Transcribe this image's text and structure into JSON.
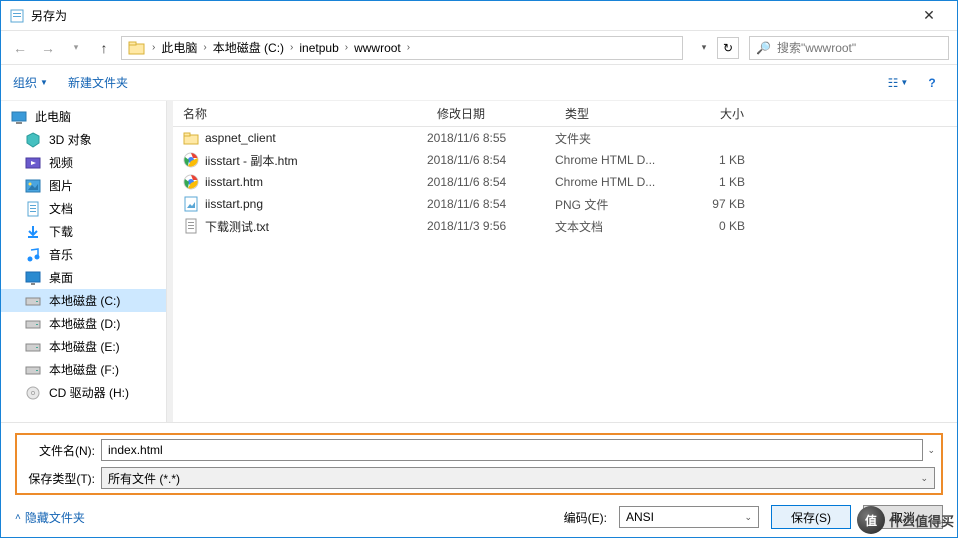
{
  "title": "另存为",
  "breadcrumbs": [
    "此电脑",
    "本地磁盘 (C:)",
    "inetpub",
    "wwwroot"
  ],
  "search_placeholder": "搜索\"wwwroot\"",
  "toolbar": {
    "organize": "组织",
    "newfolder": "新建文件夹"
  },
  "columns": {
    "name": "名称",
    "date": "修改日期",
    "type": "类型",
    "size": "大小"
  },
  "sidebar": [
    {
      "label": "此电脑",
      "icon": "pc",
      "root": true
    },
    {
      "label": "3D 对象",
      "icon": "cube"
    },
    {
      "label": "视频",
      "icon": "video"
    },
    {
      "label": "图片",
      "icon": "image"
    },
    {
      "label": "文档",
      "icon": "doc"
    },
    {
      "label": "下载",
      "icon": "download"
    },
    {
      "label": "音乐",
      "icon": "music"
    },
    {
      "label": "桌面",
      "icon": "desktop"
    },
    {
      "label": "本地磁盘 (C:)",
      "icon": "disk",
      "selected": true
    },
    {
      "label": "本地磁盘 (D:)",
      "icon": "disk"
    },
    {
      "label": "本地磁盘 (E:)",
      "icon": "disk"
    },
    {
      "label": "本地磁盘 (F:)",
      "icon": "disk"
    },
    {
      "label": "CD 驱动器 (H:)",
      "icon": "cd"
    }
  ],
  "files": [
    {
      "name": "aspnet_client",
      "date": "2018/11/6 8:55",
      "type": "文件夹",
      "size": "",
      "icon": "folder"
    },
    {
      "name": "iisstart - 副本.htm",
      "date": "2018/11/6 8:54",
      "type": "Chrome HTML D...",
      "size": "1 KB",
      "icon": "chrome"
    },
    {
      "name": "iisstart.htm",
      "date": "2018/11/6 8:54",
      "type": "Chrome HTML D...",
      "size": "1 KB",
      "icon": "chrome"
    },
    {
      "name": "iisstart.png",
      "date": "2018/11/6 8:54",
      "type": "PNG 文件",
      "size": "97 KB",
      "icon": "png"
    },
    {
      "name": "下载测试.txt",
      "date": "2018/11/3 9:56",
      "type": "文本文档",
      "size": "0 KB",
      "icon": "txt"
    }
  ],
  "filename_label": "文件名(N):",
  "filename_value": "index.html",
  "filetype_label": "保存类型(T):",
  "filetype_value": "所有文件  (*.*)",
  "hide_folders": "隐藏文件夹",
  "encoding_label": "编码(E):",
  "encoding_value": "ANSI",
  "save_btn": "保存(S)",
  "cancel_btn": "取消",
  "watermark": "什么值得买"
}
